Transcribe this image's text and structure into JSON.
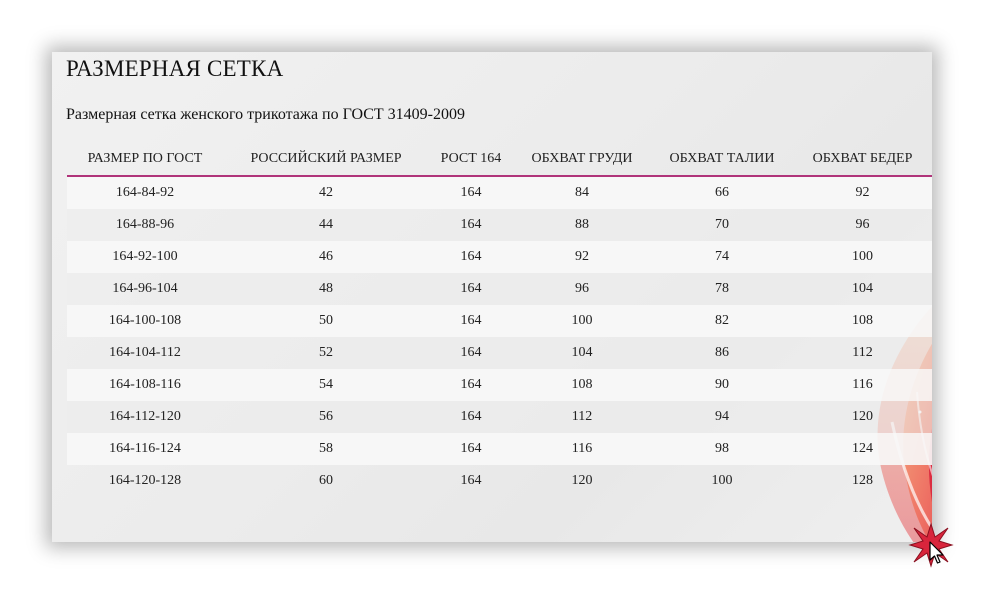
{
  "page": {
    "title": "РАЗМЕРНАЯ СЕТКА",
    "subtitle": "Размерная сетка женского трикотажа по ГОСТ 31409-2009"
  },
  "table": {
    "headers": [
      "РАЗМЕР ПО ГОСТ",
      "РОССИЙСКИЙ РАЗМЕР",
      "РОСТ 164",
      "ОБХВАТ ГРУДИ",
      "ОБХВАТ ТАЛИИ",
      "ОБХВАТ БЕДЕР"
    ],
    "rows": [
      [
        "164-84-92",
        "42",
        "164",
        "84",
        "66",
        "92"
      ],
      [
        "164-88-96",
        "44",
        "164",
        "88",
        "70",
        "96"
      ],
      [
        "164-92-100",
        "46",
        "164",
        "92",
        "74",
        "100"
      ],
      [
        "164-96-104",
        "48",
        "164",
        "96",
        "78",
        "104"
      ],
      [
        "164-100-108",
        "50",
        "164",
        "100",
        "82",
        "108"
      ],
      [
        "164-104-112",
        "52",
        "164",
        "104",
        "86",
        "112"
      ],
      [
        "164-108-116",
        "54",
        "164",
        "108",
        "90",
        "116"
      ],
      [
        "164-112-120",
        "56",
        "164",
        "112",
        "94",
        "120"
      ],
      [
        "164-116-124",
        "58",
        "164",
        "116",
        "98",
        "124"
      ],
      [
        "164-120-128",
        "60",
        "164",
        "120",
        "100",
        "128"
      ]
    ]
  },
  "colors": {
    "header_rule": "#b0347a",
    "accent_red": "#d8253c",
    "accent_orange": "#f0a060"
  },
  "icons": {
    "cursor": "mouse-pointer-icon",
    "click_burst": "click-burst-icon"
  }
}
